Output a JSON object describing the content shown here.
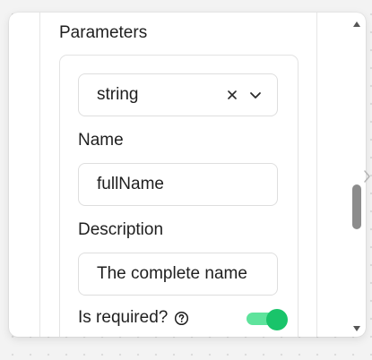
{
  "parameters": {
    "title": "Parameters",
    "type_select": {
      "value": "string",
      "clear_icon": "close-icon",
      "dropdown_icon": "chevron-down-icon"
    },
    "name_label": "Name",
    "name_value": "fullName",
    "description_label": "Description",
    "description_value": "The complete name",
    "required_label": "Is required?",
    "required_help_icon": "question-circle-icon",
    "required_on": true
  },
  "colors": {
    "toggle_track": "#5ee39c",
    "toggle_knob": "#19c46a",
    "scroll_thumb": "#8c8c8c"
  }
}
